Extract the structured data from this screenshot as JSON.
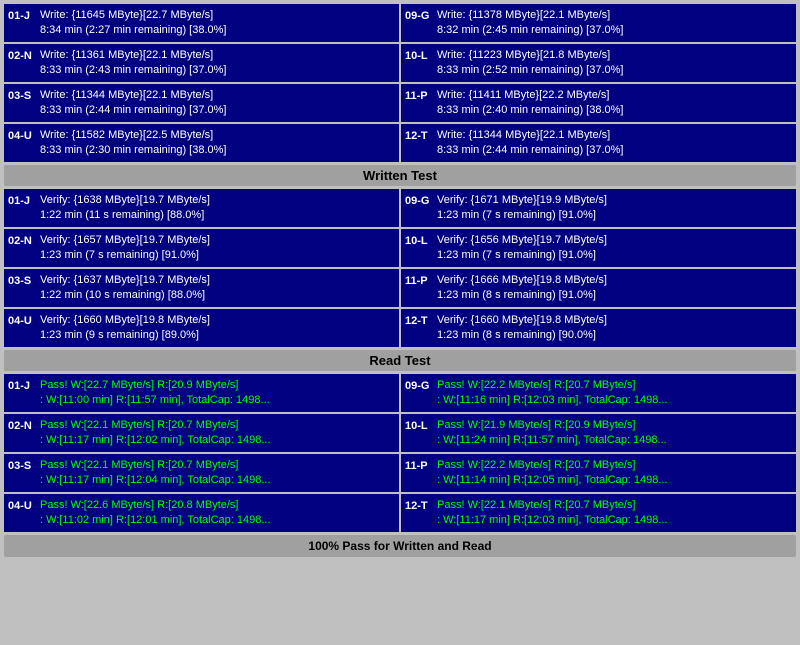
{
  "sections": {
    "write_test": {
      "label": "Written Test",
      "rows": [
        {
          "left": {
            "id": "01-J",
            "line1": "Write: {11645 MByte}[22.7 MByte/s]",
            "line2": "8:34 min (2:27 min remaining)  [38.0%]"
          },
          "right": {
            "id": "09-G",
            "line1": "Write: {11378 MByte}[22.1 MByte/s]",
            "line2": "8:32 min (2:45 min remaining)  [37.0%]"
          }
        },
        {
          "left": {
            "id": "02-N",
            "line1": "Write: {11361 MByte}[22.1 MByte/s]",
            "line2": "8:33 min (2:43 min remaining)  [37.0%]"
          },
          "right": {
            "id": "10-L",
            "line1": "Write: {11223 MByte}[21.8 MByte/s]",
            "line2": "8:33 min (2:52 min remaining)  [37.0%]"
          }
        },
        {
          "left": {
            "id": "03-S",
            "line1": "Write: {11344 MByte}[22.1 MByte/s]",
            "line2": "8:33 min (2:44 min remaining)  [37.0%]"
          },
          "right": {
            "id": "11-P",
            "line1": "Write: {11411 MByte}[22.2 MByte/s]",
            "line2": "8:33 min (2:40 min remaining)  [38.0%]"
          }
        },
        {
          "left": {
            "id": "04-U",
            "line1": "Write: {11582 MByte}[22.5 MByte/s]",
            "line2": "8:33 min (2:30 min remaining)  [38.0%]"
          },
          "right": {
            "id": "12-T",
            "line1": "Write: {11344 MByte}[22.1 MByte/s]",
            "line2": "8:33 min (2:44 min remaining)  [37.0%]"
          }
        }
      ]
    },
    "verify_test": {
      "label": "Written Test",
      "rows": [
        {
          "left": {
            "id": "01-J",
            "line1": "Verify: {1638 MByte}[19.7 MByte/s]",
            "line2": "1:22 min (11 s remaining)  [88.0%]"
          },
          "right": {
            "id": "09-G",
            "line1": "Verify: {1671 MByte}[19.9 MByte/s]",
            "line2": "1:23 min (7 s remaining)  [91.0%]"
          }
        },
        {
          "left": {
            "id": "02-N",
            "line1": "Verify: {1657 MByte}[19.7 MByte/s]",
            "line2": "1:23 min (7 s remaining)  [91.0%]"
          },
          "right": {
            "id": "10-L",
            "line1": "Verify: {1656 MByte}[19.7 MByte/s]",
            "line2": "1:23 min (7 s remaining)  [91.0%]"
          }
        },
        {
          "left": {
            "id": "03-S",
            "line1": "Verify: {1637 MByte}[19.7 MByte/s]",
            "line2": "1:22 min (10 s remaining)  [88.0%]"
          },
          "right": {
            "id": "11-P",
            "line1": "Verify: {1666 MByte}[19.8 MByte/s]",
            "line2": "1:23 min (8 s remaining)  [91.0%]"
          }
        },
        {
          "left": {
            "id": "04-U",
            "line1": "Verify: {1660 MByte}[19.8 MByte/s]",
            "line2": "1:23 min (9 s remaining)  [89.0%]"
          },
          "right": {
            "id": "12-T",
            "line1": "Verify: {1660 MByte}[19.8 MByte/s]",
            "line2": "1:23 min (8 s remaining)  [90.0%]"
          }
        }
      ]
    },
    "read_test": {
      "label": "Read Test",
      "rows": [
        {
          "left": {
            "id": "01-J",
            "line1": "Pass! W:[22.7 MByte/s] R:[20.9 MByte/s]",
            "line2": ": W:[11:00 min] R:[11:57 min], TotalCap: 1498..."
          },
          "right": {
            "id": "09-G",
            "line1": "Pass! W:[22.2 MByte/s] R:[20.7 MByte/s]",
            "line2": ": W:[11:16 min] R:[12:03 min], TotalCap: 1498..."
          }
        },
        {
          "left": {
            "id": "02-N",
            "line1": "Pass! W:[22.1 MByte/s] R:[20.7 MByte/s]",
            "line2": ": W:[11:17 min] R:[12:02 min], TotalCap: 1498..."
          },
          "right": {
            "id": "10-L",
            "line1": "Pass! W:[21.9 MByte/s] R:[20.9 MByte/s]",
            "line2": ": W:[11:24 min] R:[11:57 min], TotalCap: 1498..."
          }
        },
        {
          "left": {
            "id": "03-S",
            "line1": "Pass! W:[22.1 MByte/s] R:[20.7 MByte/s]",
            "line2": ": W:[11:17 min] R:[12:04 min], TotalCap: 1498..."
          },
          "right": {
            "id": "11-P",
            "line1": "Pass! W:[22.2 MByte/s] R:[20.7 MByte/s]",
            "line2": ": W:[11:14 min] R:[12:05 min], TotalCap: 1498..."
          }
        },
        {
          "left": {
            "id": "04-U",
            "line1": "Pass! W:[22.6 MByte/s] R:[20.8 MByte/s]",
            "line2": ": W:[11:02 min] R:[12:01 min], TotalCap: 1498..."
          },
          "right": {
            "id": "12-T",
            "line1": "Pass! W:[22.1 MByte/s] R:[20.7 MByte/s]",
            "line2": ": W:[11:17 min] R:[12:03 min], TotalCap: 1498..."
          }
        }
      ]
    }
  },
  "headers": {
    "write": "Written Test",
    "read": "Read Test",
    "footer": "100% Pass for Written and Read"
  }
}
